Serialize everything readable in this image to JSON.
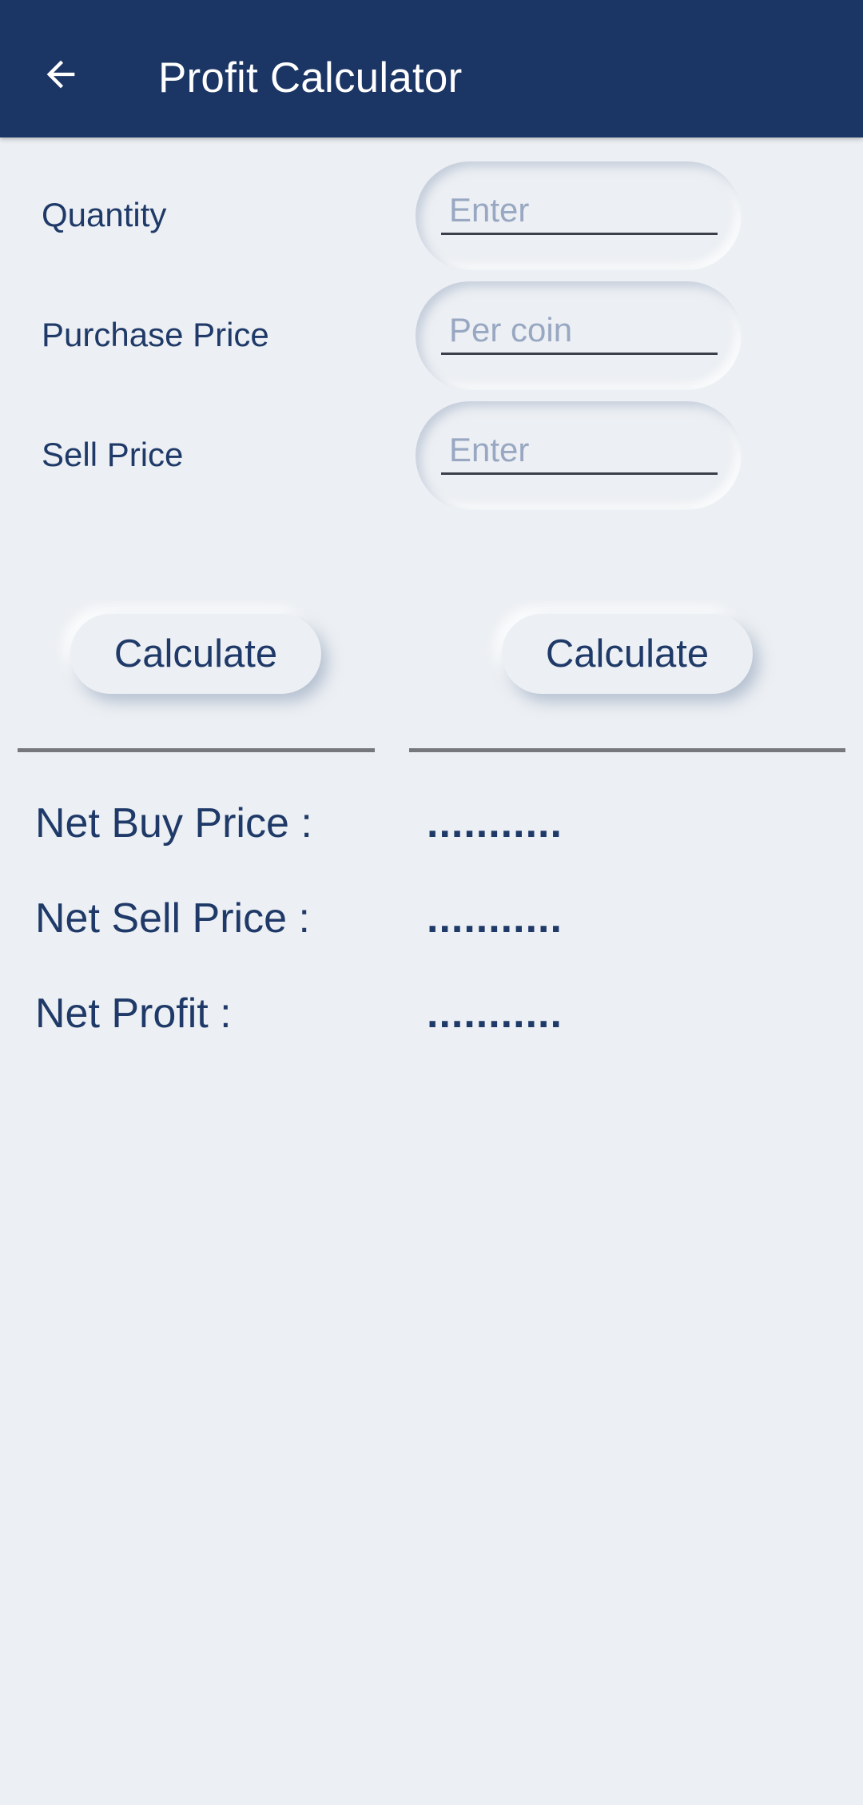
{
  "app_bar": {
    "title": "Profit Calculator",
    "back_icon": "arrow-left-icon",
    "background_color": "#1b3564"
  },
  "form": {
    "fields": [
      {
        "label": "Quantity",
        "placeholder": "Enter",
        "value": ""
      },
      {
        "label": "Purchase Price",
        "placeholder": "Per coin",
        "value": ""
      },
      {
        "label": "Sell Price",
        "placeholder": "Enter",
        "value": ""
      }
    ]
  },
  "actions": {
    "left_button_label": "Calculate",
    "right_button_label": "Calculate"
  },
  "results": {
    "items": [
      {
        "label": "Net Buy Price :",
        "value": "..........."
      },
      {
        "label": "Net Sell Price :",
        "value": "..........."
      },
      {
        "label": "Net Profit :",
        "value": "..........."
      }
    ]
  },
  "theme": {
    "background": "#eceff3",
    "text": "#1f3a68",
    "placeholder": "#98a7c2"
  }
}
